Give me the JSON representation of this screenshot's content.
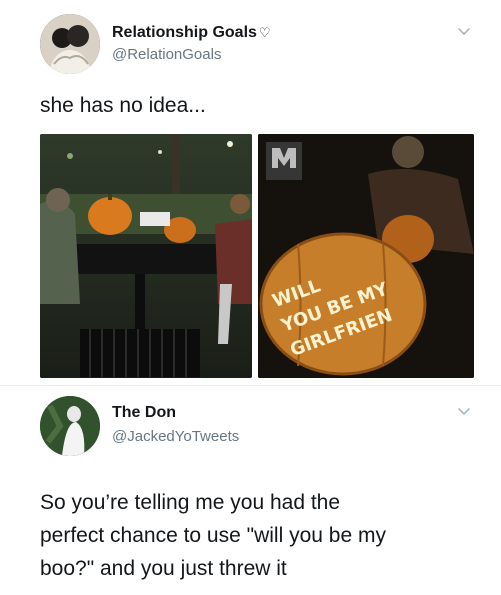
{
  "tweet1": {
    "display_name": "Relationship Goals",
    "handle": "@RelationGoals",
    "text": "she has no idea...",
    "images": [
      {
        "description_icon": "pumpkin-carving-photo"
      },
      {
        "description_icon": "pumpkin-message-photo",
        "pumpkin_message_lines": [
          "WILL",
          "YOU BE MY",
          "GIRLFRIEN"
        ],
        "watermark": "DANK MEMEOLOGY"
      }
    ],
    "chevron": "chevron-down-icon"
  },
  "tweet2": {
    "display_name": "The Don",
    "handle": "@JackedYoTweets",
    "text_lines": [
      "So you’re telling me you had the",
      "perfect chance to use \"will you be my",
      "boo?\" and you just threw it"
    ],
    "chevron": "chevron-down-icon"
  },
  "colors": {
    "background": "#ffffff",
    "primary_text": "#14171a",
    "secondary_text": "#657786",
    "divider": "#e6ecf0"
  }
}
